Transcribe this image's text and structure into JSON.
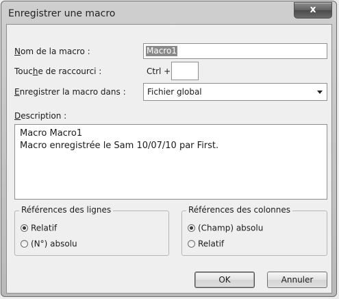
{
  "dialog": {
    "title": "Enregistrer une macro",
    "close_label": "x"
  },
  "macro_name": {
    "label": "Nom de la macro :",
    "value": "Macro1"
  },
  "shortcut": {
    "label": "Touche de raccourci :",
    "prefix": "Ctrl +",
    "value": ""
  },
  "store_in": {
    "label": "Enregistrer la macro dans :",
    "selected": "Fichier global"
  },
  "description": {
    "label": "Description :",
    "lines": [
      "Macro Macro1",
      "Macro enregistrée le Sam 10/07/10 par First."
    ]
  },
  "row_refs": {
    "legend": "Références des lignes",
    "options": [
      {
        "label": "Relatif",
        "checked": true
      },
      {
        "label": "(N°) absolu",
        "checked": false
      }
    ]
  },
  "col_refs": {
    "legend": "Références des colonnes",
    "options": [
      {
        "label": "(Champ) absolu",
        "checked": true
      },
      {
        "label": "Relatif",
        "checked": false
      }
    ]
  },
  "buttons": {
    "ok": "OK",
    "cancel": "Annuler"
  }
}
